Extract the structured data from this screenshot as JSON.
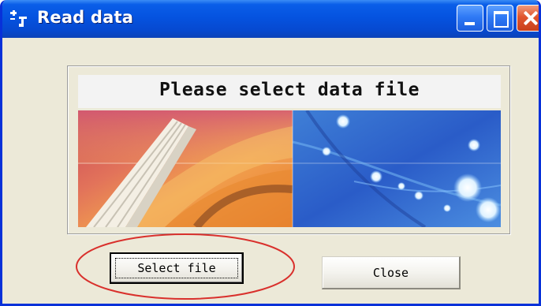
{
  "window": {
    "title": "Read data",
    "icons": {
      "app": "app-settings-icon",
      "minimize": "minimize-icon",
      "maximize": "maximize-icon",
      "close": "close-icon"
    },
    "colors": {
      "titlebar": "#0553e0",
      "frame": "#0831d9",
      "body": "#ece9d8",
      "close_button": "#e0552e",
      "annotation": "#d9302c"
    }
  },
  "banner": {
    "heading": "Please select data file"
  },
  "buttons": {
    "select_file": "Select file",
    "close": "Close"
  }
}
